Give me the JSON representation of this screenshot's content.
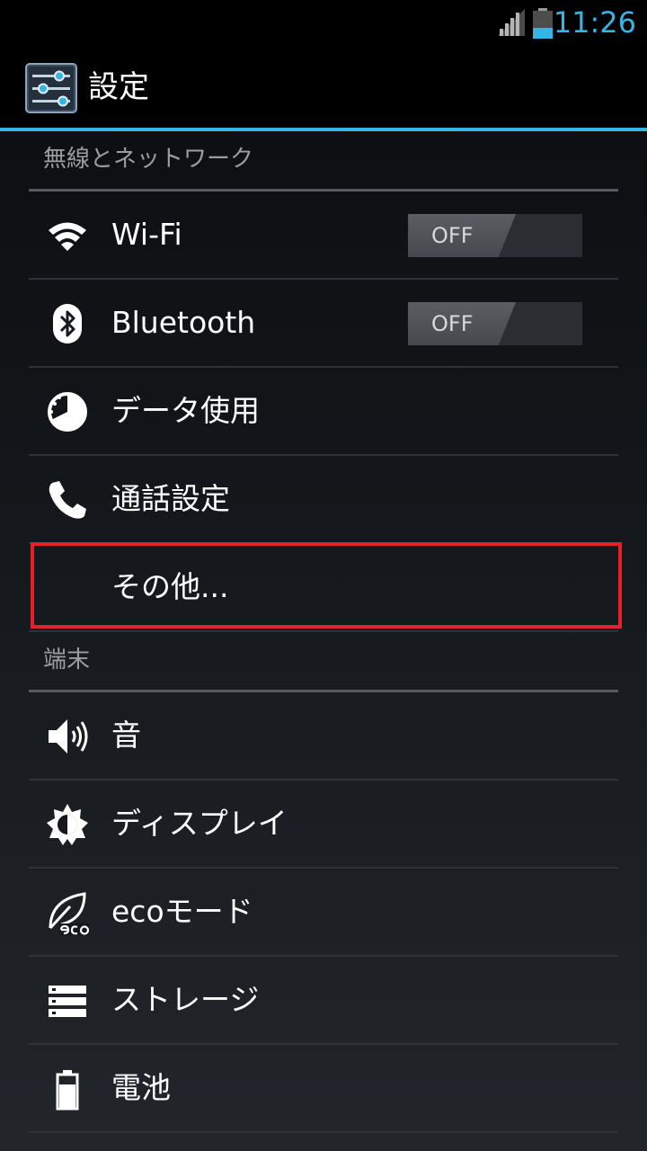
{
  "status_bar": {
    "time": "11:26",
    "signal_icon": "signal-icon",
    "battery_icon": "battery-icon",
    "accent_color": "#33b5e5"
  },
  "action_bar": {
    "title": "設定",
    "icon": "settings-sliders-icon"
  },
  "sections": [
    {
      "header": "無線とネットワーク",
      "items": [
        {
          "label": "Wi-Fi",
          "icon": "wifi-icon",
          "toggle": "OFF"
        },
        {
          "label": "Bluetooth",
          "icon": "bluetooth-icon",
          "toggle": "OFF"
        },
        {
          "label": "データ使用",
          "icon": "data-usage-icon"
        },
        {
          "label": "通話設定",
          "icon": "phone-icon"
        },
        {
          "label": "その他...",
          "icon": ""
        }
      ]
    },
    {
      "header": "端末",
      "items": [
        {
          "label": "音",
          "icon": "speaker-icon"
        },
        {
          "label": "ディスプレイ",
          "icon": "brightness-icon"
        },
        {
          "label": "ecoモード",
          "icon": "eco-leaf-icon"
        },
        {
          "label": "ストレージ",
          "icon": "storage-icon"
        },
        {
          "label": "電池",
          "icon": "battery-item-icon"
        }
      ]
    }
  ],
  "highlight_color": "#e3202b"
}
